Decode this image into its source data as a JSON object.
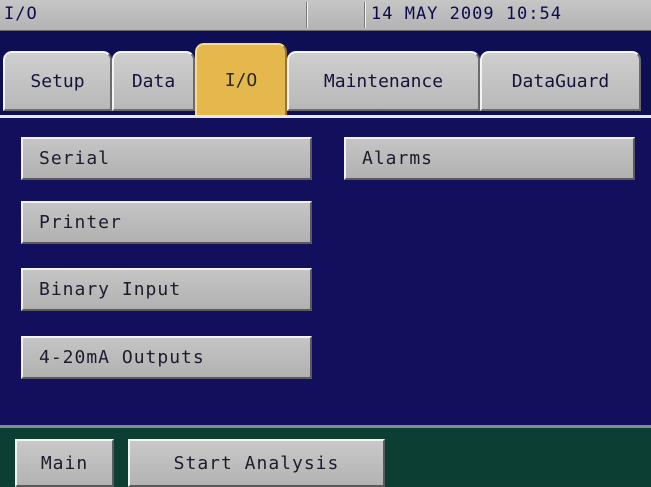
{
  "status_bar": {
    "title": "I/O",
    "datetime": "14 MAY 2009 10:54"
  },
  "tabs": [
    {
      "label": "Setup",
      "active": false
    },
    {
      "label": "Data",
      "active": false
    },
    {
      "label": "I/O",
      "active": true
    },
    {
      "label": "Maintenance",
      "active": false
    },
    {
      "label": "DataGuard",
      "active": false
    }
  ],
  "menu": {
    "serial": "Serial",
    "printer": "Printer",
    "binary_input": "Binary Input",
    "outputs_4_20ma": "4-20mA Outputs",
    "alarms": "Alarms"
  },
  "footer": {
    "main": "Main",
    "start_analysis": "Start Analysis"
  },
  "colors": {
    "background": "#12105c",
    "active_tab": "#e4b84c",
    "footer": "#0c3e34",
    "button": "#c0c0c0"
  }
}
